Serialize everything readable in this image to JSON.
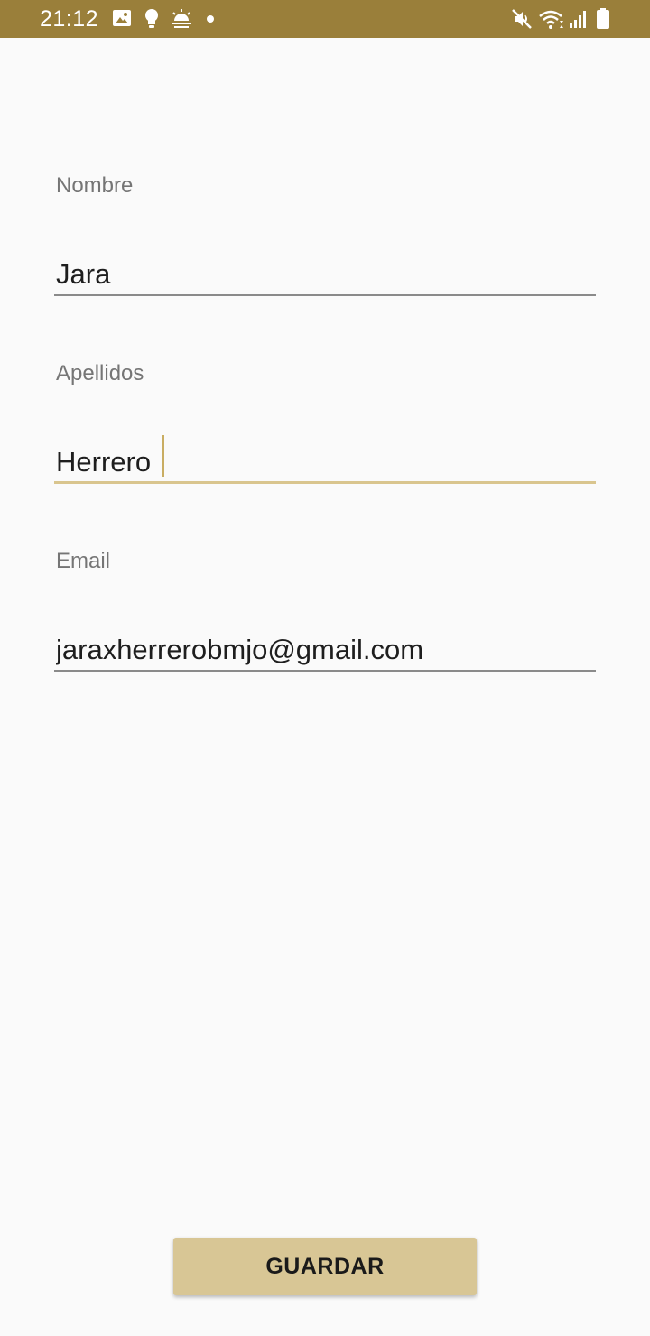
{
  "status_bar": {
    "time": "21:12",
    "icons": [
      "image-icon",
      "bulb-icon",
      "weather-icon",
      "dot-icon",
      "mute-icon",
      "wifi-icon",
      "signal-icon",
      "battery-icon"
    ],
    "background": "#9a7f3a"
  },
  "form": {
    "nombre": {
      "label": "Nombre",
      "value": "Jara"
    },
    "apellidos": {
      "label": "Apellidos",
      "value": "Herrero"
    },
    "email": {
      "label": "Email",
      "value": "jaraxherrerobmjo@gmail.com"
    }
  },
  "actions": {
    "save_label": "GUARDAR"
  },
  "colors": {
    "accent": "#d8c695",
    "focus_underline": "#d9c58e",
    "background": "#fafafa"
  }
}
